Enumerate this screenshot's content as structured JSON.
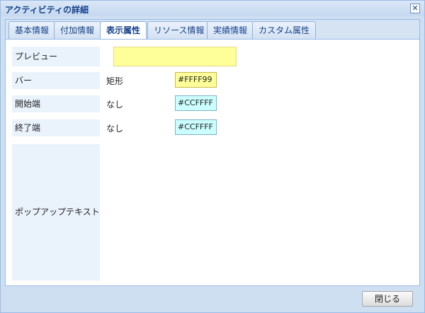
{
  "window": {
    "title": "アクティビティの詳細",
    "close_glyph": "✕"
  },
  "tabs": [
    {
      "label": "基本情報"
    },
    {
      "label": "付加情報"
    },
    {
      "label": "表示属性"
    },
    {
      "label": "リソース情報"
    },
    {
      "label": "実績情報"
    },
    {
      "label": "カスタム属性"
    }
  ],
  "active_tab": "表示属性",
  "form": {
    "preview_label": "プレビュー",
    "preview_color": "#FFFF99",
    "bar_label": "バー",
    "bar_shape": "矩形",
    "bar_color": "#FFFF99",
    "start_label": "開始端",
    "start_shape": "なし",
    "start_color": "#CCFFFF",
    "end_label": "終了端",
    "end_shape": "なし",
    "end_color": "#CCFFFF",
    "popup_label": "ポップアップテキスト"
  },
  "footer": {
    "close_button": "閉じる"
  }
}
